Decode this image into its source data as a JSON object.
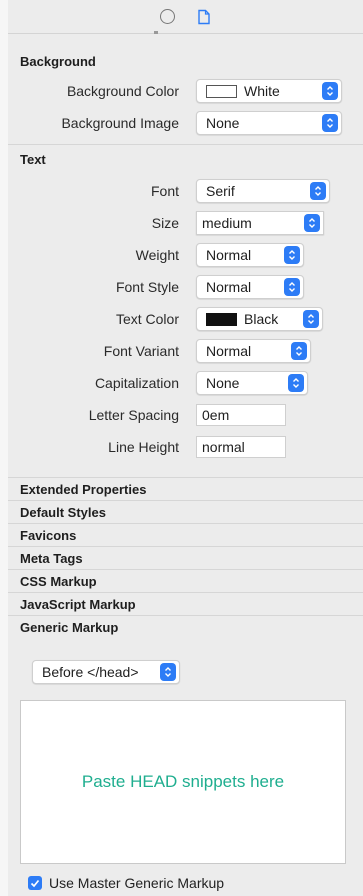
{
  "background": {
    "title": "Background",
    "color_label": "Background Color",
    "color_value": "White",
    "image_label": "Background Image",
    "image_value": "None"
  },
  "text": {
    "title": "Text",
    "font_label": "Font",
    "font_value": "Serif",
    "size_label": "Size",
    "size_value": "medium",
    "weight_label": "Weight",
    "weight_value": "Normal",
    "style_label": "Font Style",
    "style_value": "Normal",
    "color_label": "Text Color",
    "color_value": "Black",
    "variant_label": "Font Variant",
    "variant_value": "Normal",
    "cap_label": "Capitalization",
    "cap_value": "None",
    "spacing_label": "Letter Spacing",
    "spacing_value": "0em",
    "lineheight_label": "Line Height",
    "lineheight_value": "normal"
  },
  "sections": [
    "Extended Properties",
    "Default Styles",
    "Favicons",
    "Meta Tags",
    "CSS Markup",
    "JavaScript Markup",
    "Generic Markup"
  ],
  "generic": {
    "position_value": "Before </head>",
    "placeholder": "Paste HEAD snippets here",
    "checkbox_label": "Use Master Generic Markup",
    "checkbox_checked": true
  },
  "icons": {
    "top_left": "circle-icon",
    "top_right": "document-icon"
  },
  "colors": {
    "accent": "#2d7cf6",
    "placeholder_text": "#1fae8f"
  }
}
